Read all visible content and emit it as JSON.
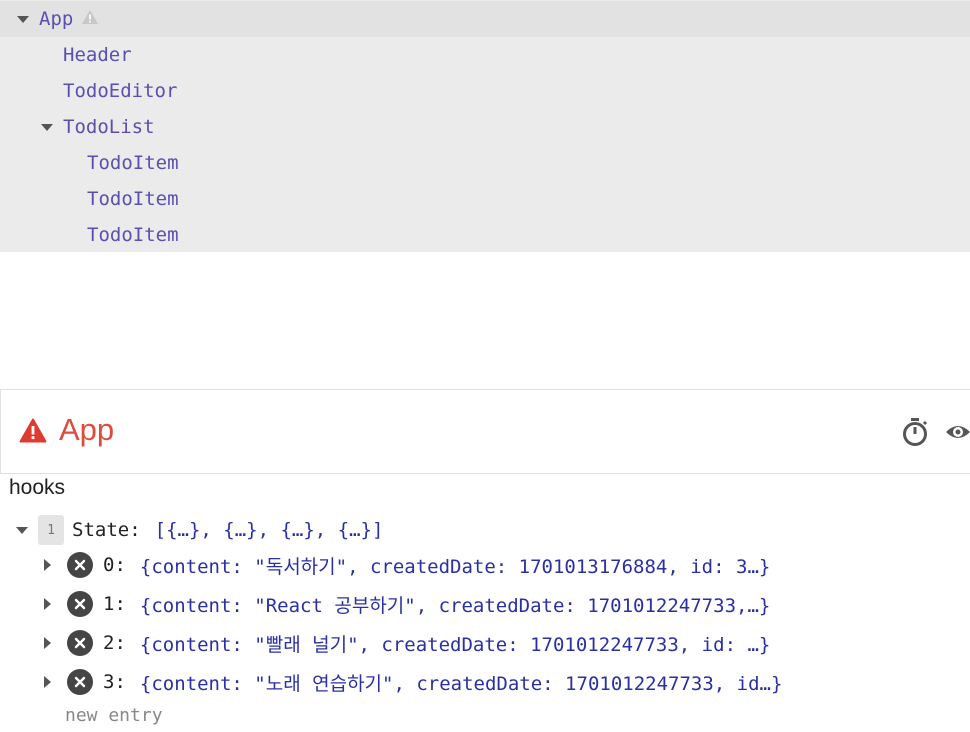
{
  "tree": {
    "nodes": [
      {
        "label": "App",
        "expanded": true,
        "warning": true
      },
      {
        "label": "Header"
      },
      {
        "label": "TodoEditor"
      },
      {
        "label": "TodoList",
        "expanded": true
      },
      {
        "label": "TodoItem"
      },
      {
        "label": "TodoItem"
      },
      {
        "label": "TodoItem"
      }
    ]
  },
  "inspector": {
    "title": "App",
    "title_color": "#dd4c3d",
    "icons": [
      "warning-icon",
      "stopwatch-icon",
      "eye-icon"
    ]
  },
  "hooks": {
    "label": "hooks",
    "state": {
      "index": "1",
      "key": "State:",
      "summary": "[{…}, {…}, {…}, {…}]",
      "entries": [
        {
          "key": "0:",
          "value": "{content: \"독서하기\", createdDate: 1701013176884, id: 3…}"
        },
        {
          "key": "1:",
          "value": "{content: \"React 공부하기\", createdDate: 1701012247733,…}"
        },
        {
          "key": "2:",
          "value": "{content: \"빨래 널기\", createdDate: 1701012247733, id: …}"
        },
        {
          "key": "3:",
          "value": "{content: \"노래 연습하기\", createdDate: 1701012247733, id…}"
        }
      ],
      "new_entry_placeholder": "new entry"
    }
  }
}
